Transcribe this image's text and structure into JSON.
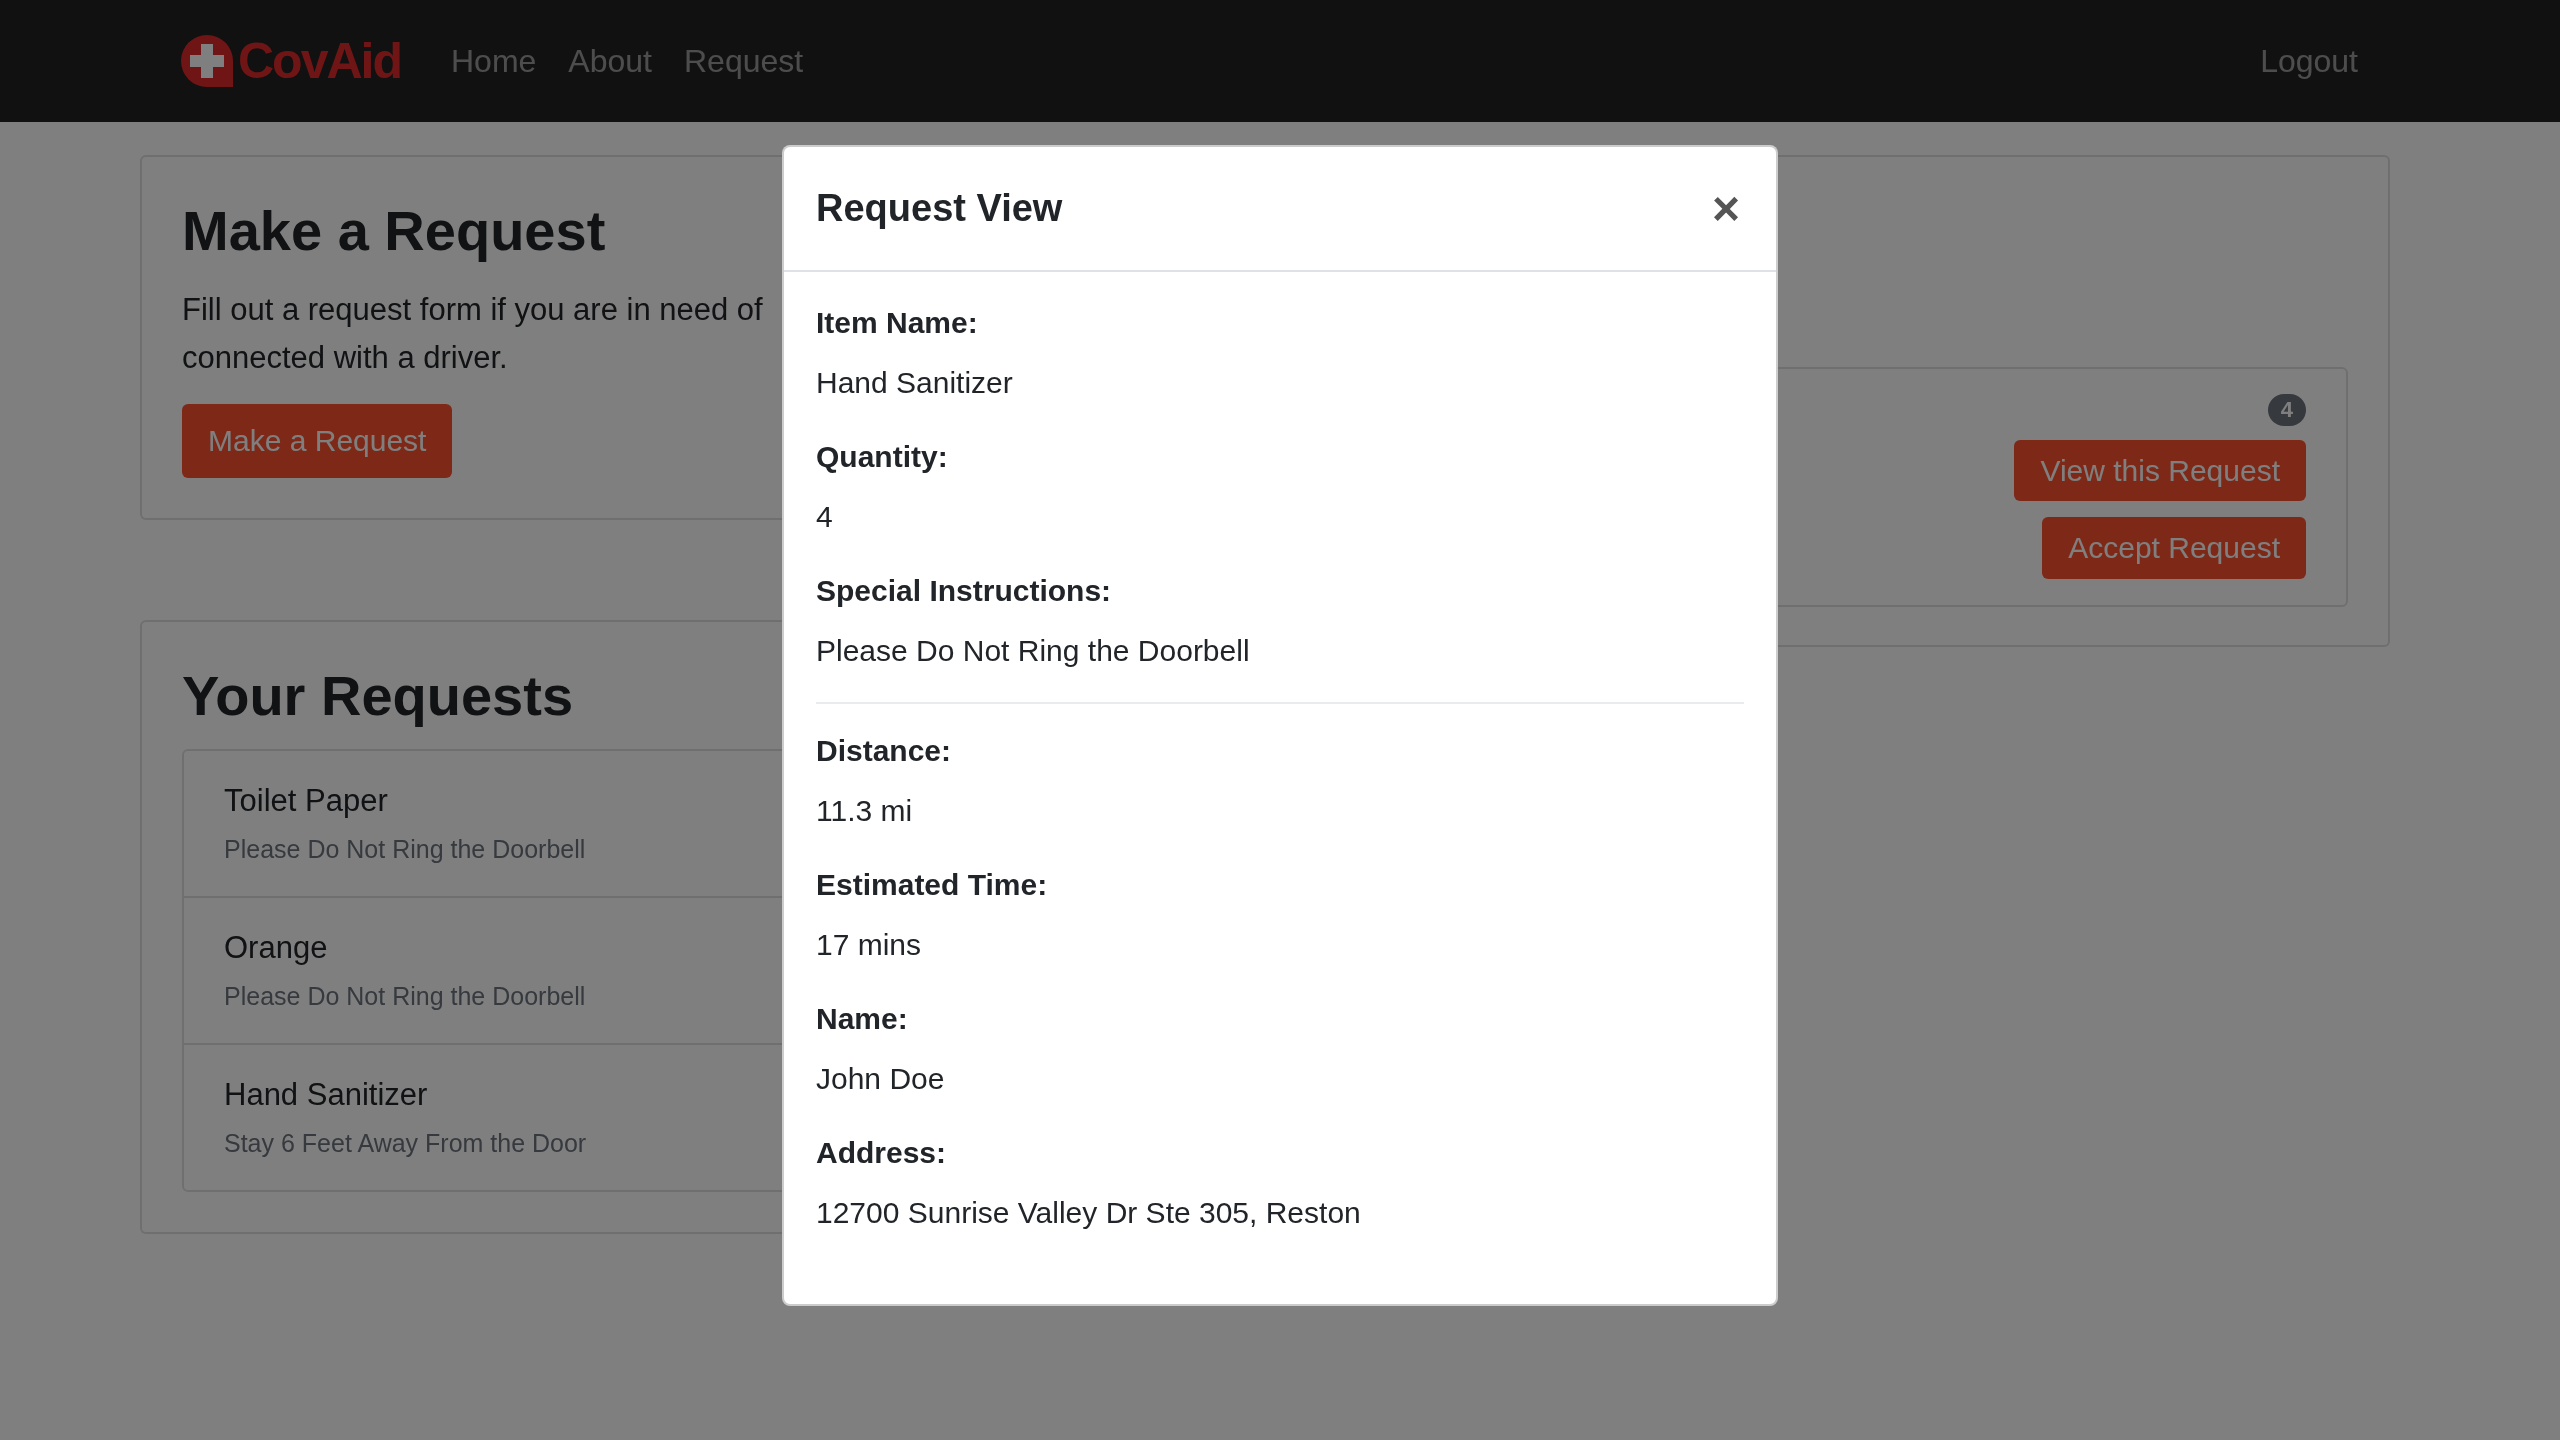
{
  "navbar": {
    "brand": "CovAid",
    "links": [
      {
        "label": "Home"
      },
      {
        "label": "About"
      },
      {
        "label": "Request"
      }
    ],
    "logout": "Logout"
  },
  "make_request": {
    "title": "Make a Request",
    "text_lines": [
      "Fill out a request form if you are in need of",
      "connected with a driver."
    ],
    "button": "Make a Request"
  },
  "your_requests": {
    "title": "Your Requests",
    "items": [
      {
        "title": "Toilet Paper",
        "subtitle": "Please Do Not Ring the Doorbell"
      },
      {
        "title": "Orange",
        "subtitle": "Please Do Not Ring the Doorbell"
      },
      {
        "title": "Hand Sanitizer",
        "subtitle": "Stay 6 Feet Away From the Door"
      }
    ]
  },
  "request_card": {
    "badge": "4",
    "buttons": [
      "View this Request",
      "Accept Request"
    ]
  },
  "modal": {
    "title": "Request View",
    "close": "×",
    "sections": [
      {
        "fields": [
          {
            "label": "Item Name:",
            "value": "Hand Sanitizer"
          },
          {
            "label": "Quantity:",
            "value": "4"
          },
          {
            "label": "Special Instructions:",
            "value": "Please Do Not Ring the Doorbell"
          }
        ]
      },
      {
        "fields": [
          {
            "label": "Distance:",
            "value": "11.3 mi"
          },
          {
            "label": "Estimated Time:",
            "value": "17 mins"
          },
          {
            "label": "Name:",
            "value": "John Doe"
          },
          {
            "label": "Address:",
            "value": "12700 Sunrise Valley Dr Ste 305, Reston"
          }
        ]
      }
    ]
  }
}
